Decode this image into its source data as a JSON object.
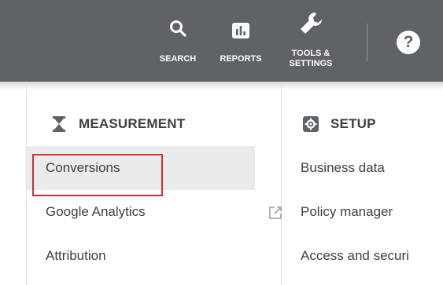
{
  "toolbar": {
    "search_label": "SEARCH",
    "reports_label": "REPORTS",
    "tools_label": "TOOLS &\nSETTINGS",
    "help_label": "?"
  },
  "measurement": {
    "title": "MEASUREMENT",
    "items": [
      {
        "label": "Conversions"
      },
      {
        "label": "Google Analytics"
      },
      {
        "label": "Attribution"
      }
    ]
  },
  "setup": {
    "title": "SETUP",
    "items": [
      {
        "label": "Business data"
      },
      {
        "label": "Policy manager"
      },
      {
        "label": "Access and securi"
      }
    ]
  },
  "colors": {
    "toolbar_bg": "#5f6368",
    "highlight_border": "#d32f2f",
    "selected_bg": "#ebebeb"
  }
}
